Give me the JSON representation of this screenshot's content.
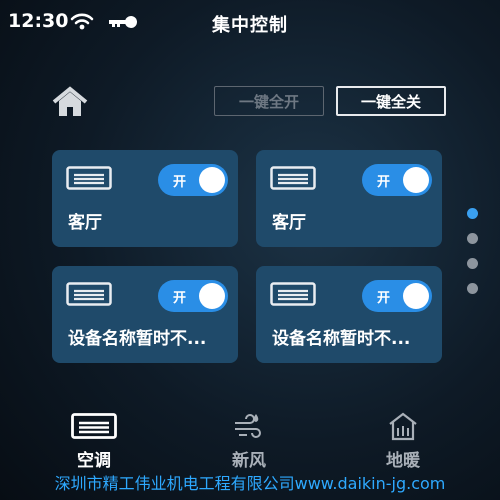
{
  "status_bar": {
    "time": "12:30"
  },
  "header": {
    "title": "集中控制"
  },
  "actions": {
    "all_on_label": "一键全开",
    "all_off_label": "一键全关"
  },
  "devices": [
    {
      "name": "客厅",
      "toggle_label": "开",
      "state": "on"
    },
    {
      "name": "客厅",
      "toggle_label": "开",
      "state": "on"
    },
    {
      "name": "设备名称暂时不...",
      "toggle_label": "开",
      "state": "on"
    },
    {
      "name": "设备名称暂时不...",
      "toggle_label": "开",
      "state": "on"
    }
  ],
  "pagination": {
    "pages": 4,
    "current": 1
  },
  "tabs": [
    {
      "label": "空调",
      "icon": "ac-icon",
      "active": true
    },
    {
      "label": "新风",
      "icon": "fresh-air-icon",
      "active": false
    },
    {
      "label": "地暖",
      "icon": "floor-heating-icon",
      "active": false
    }
  ],
  "watermark": "深圳市精工伟业机电工程有限公司www.daikin-jg.com",
  "colors": {
    "card": "#1f4a6a",
    "toggle_on": "#2a8ee6",
    "active_dot": "#3aa0f0",
    "watermark": "#2ea9ff"
  }
}
